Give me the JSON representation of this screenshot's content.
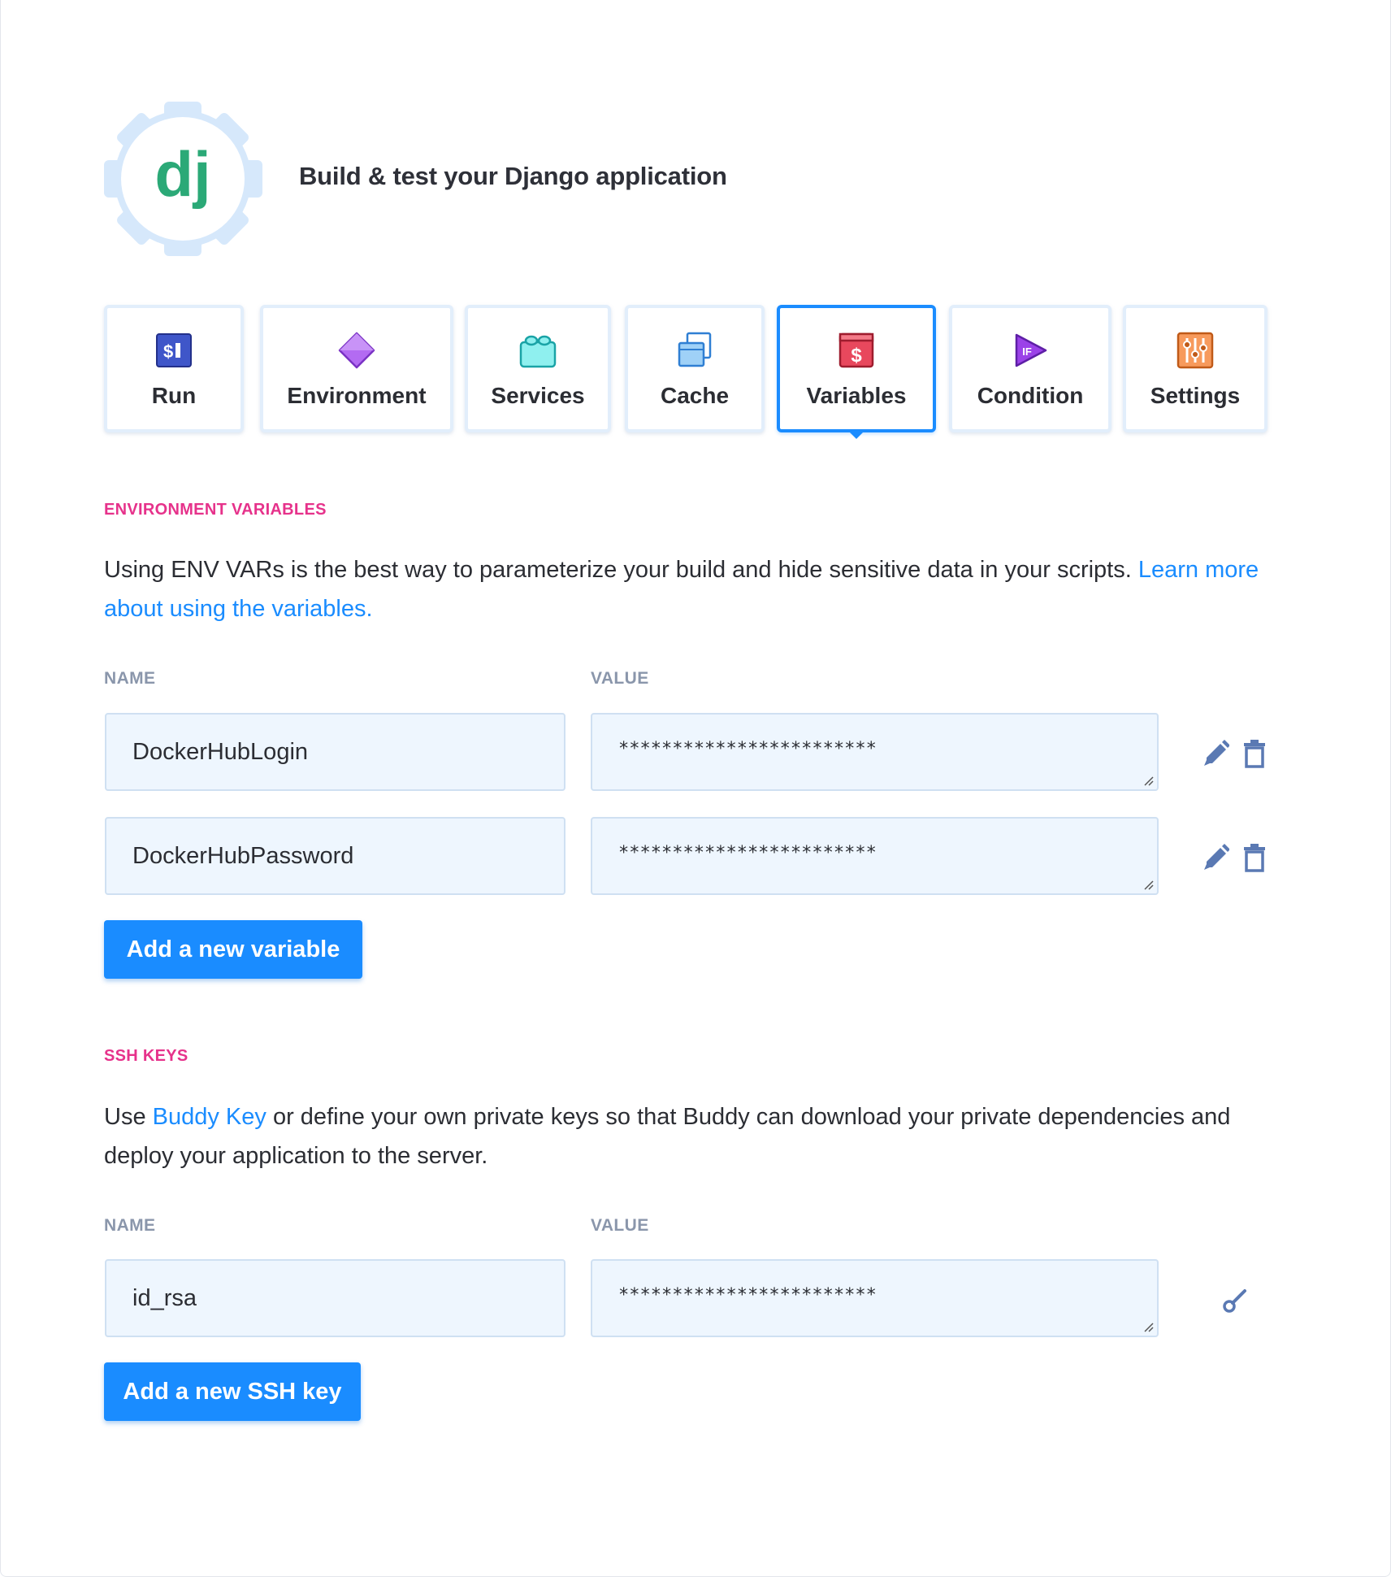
{
  "header": {
    "logo_text": "dj",
    "title": "Build & test your Django application"
  },
  "tabs": [
    {
      "label": "Run",
      "icon": "run-icon"
    },
    {
      "label": "Environment",
      "icon": "environment-icon"
    },
    {
      "label": "Services",
      "icon": "services-icon"
    },
    {
      "label": "Cache",
      "icon": "cache-icon"
    },
    {
      "label": "Variables",
      "icon": "variables-icon",
      "active": true
    },
    {
      "label": "Condition",
      "icon": "condition-icon"
    },
    {
      "label": "Settings",
      "icon": "settings-icon"
    }
  ],
  "env": {
    "section_title": "ENVIRONMENT VARIABLES",
    "desc_text": "Using ENV VARs is the best way to parameterize your build and hide sensitive data in your scripts. ",
    "desc_link": "Learn more about using the variables.",
    "name_header": "NAME",
    "value_header": "VALUE",
    "rows": [
      {
        "name": "DockerHubLogin",
        "value": "************************"
      },
      {
        "name": "DockerHubPassword",
        "value": "************************"
      }
    ],
    "add_button": "Add a new variable"
  },
  "ssh": {
    "section_title": "SSH KEYS",
    "desc_prefix": "Use ",
    "desc_link": "Buddy Key",
    "desc_suffix": " or define your own private keys so that Buddy can download your private dependencies and deploy your application to the server.",
    "name_header": "NAME",
    "value_header": "VALUE",
    "rows": [
      {
        "name": "id_rsa",
        "value": "************************"
      }
    ],
    "add_button": "Add a new SSH key"
  },
  "colors": {
    "accent": "#1a8cff",
    "section_label": "#e6328b",
    "django_green": "#2ba977",
    "field_bg": "#eef6fe"
  }
}
